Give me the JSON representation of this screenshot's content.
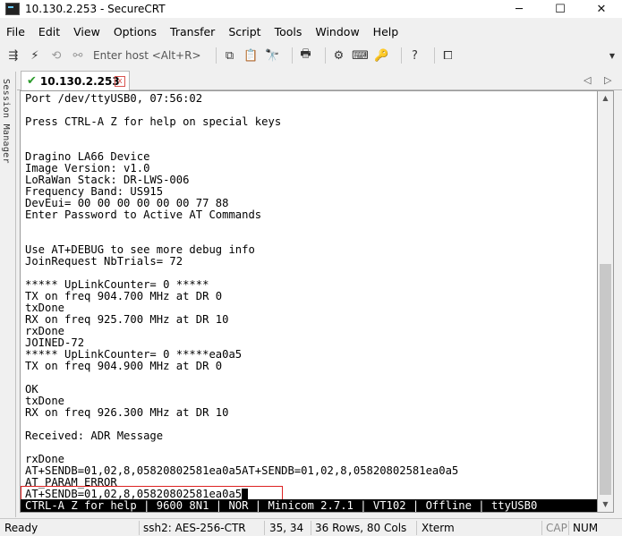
{
  "window": {
    "title": "10.130.2.253 - SecureCRT",
    "minimize": "─",
    "maximize": "☐",
    "close": "✕"
  },
  "menu": [
    "File",
    "Edit",
    "View",
    "Options",
    "Transfer",
    "Script",
    "Tools",
    "Window",
    "Help"
  ],
  "toolbar": {
    "host_placeholder": "Enter host <Alt+R>"
  },
  "session_manager": {
    "label": "Session Manager"
  },
  "tab": {
    "label": "10.130.2.253",
    "close": "x"
  },
  "terminal": {
    "lines": [
      "Port /dev/ttyUSB0, 07:56:02",
      "",
      "Press CTRL-A Z for help on special keys",
      "",
      "",
      "Dragino LA66 Device",
      "Image Version: v1.0",
      "LoRaWan Stack: DR-LWS-006",
      "Frequency Band: US915",
      "DevEui= 00 00 00 00 00 00 77 88",
      "Enter Password to Active AT Commands",
      "",
      "",
      "Use AT+DEBUG to see more debug info",
      "JoinRequest NbTrials= 72",
      "",
      "***** UpLinkCounter= 0 *****",
      "TX on freq 904.700 MHz at DR 0",
      "txDone",
      "RX on freq 925.700 MHz at DR 10",
      "rxDone",
      "JOINED-72",
      "***** UpLinkCounter= 0 *****ea0a5",
      "TX on freq 904.900 MHz at DR 0",
      "",
      "OK",
      "txDone",
      "RX on freq 926.300 MHz at DR 10",
      "",
      "Received: ADR Message",
      "",
      "rxDone",
      "AT+SENDB=01,02,8,05820802581ea0a5AT+SENDB=01,02,8,05820802581ea0a5",
      "AT_PARAM_ERROR",
      "AT+SENDB=01,02,8,05820802581ea0a5"
    ],
    "status_line": "CTRL-A Z for help | 9600 8N1 | NOR | Minicom 2.7.1 | VT102 | Offline | ttyUSB0"
  },
  "statusbar": {
    "ready": "Ready",
    "cipher": "ssh2: AES-256-CTR",
    "position": "35,  34",
    "size": "36 Rows, 80 Cols",
    "emulation": "Xterm",
    "cap": "CAP",
    "num": "NUM"
  }
}
